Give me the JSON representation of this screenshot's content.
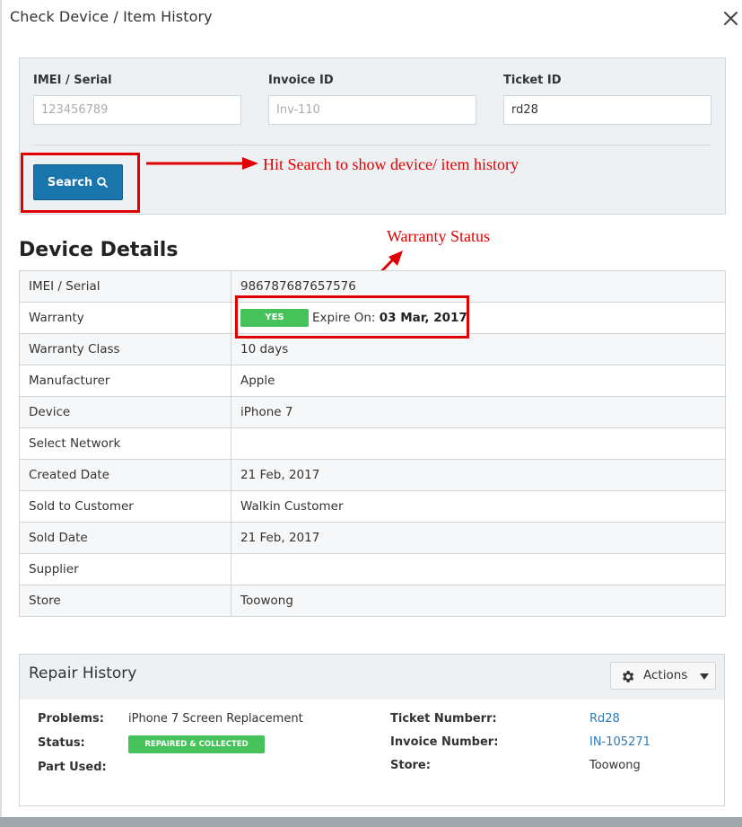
{
  "modal": {
    "title": "Check Device / Item History",
    "close_icon": "close-icon"
  },
  "search": {
    "imei_label": "IMEI / Serial",
    "imei_placeholder": "123456789",
    "imei_value": "",
    "invoice_label": "Invoice ID",
    "invoice_placeholder": "Inv-110",
    "invoice_value": "",
    "ticket_label": "Ticket ID",
    "ticket_placeholder": "",
    "ticket_value": "rd28",
    "button_label": "Search",
    "button_icon": "search-icon",
    "button_color": "#1b75ad"
  },
  "annotations": {
    "search_hint": "Hit Search to show device/ item history",
    "warranty_hint": "Warranty Status",
    "color": "#e00000"
  },
  "device_details": {
    "title": "Device Details",
    "rows": [
      {
        "key": "IMEI / Serial",
        "value": "986787687657576"
      },
      {
        "key": "Warranty",
        "value": ""
      },
      {
        "key": "Warranty Class",
        "value": "10 days"
      },
      {
        "key": "Manufacturer",
        "value": "Apple"
      },
      {
        "key": "Device",
        "value": "iPhone 7"
      },
      {
        "key": "Select Network",
        "value": ""
      },
      {
        "key": "Created Date",
        "value": "21 Feb, 2017"
      },
      {
        "key": "Sold to Customer",
        "value": "Walkin Customer"
      },
      {
        "key": "Sold Date",
        "value": "21 Feb, 2017"
      },
      {
        "key": "Supplier",
        "value": ""
      },
      {
        "key": "Store",
        "value": "Toowong"
      }
    ],
    "warranty": {
      "badge": "YES",
      "badge_color": "#45c25a",
      "expire_label": "Expire On:",
      "expire_date": "03 Mar, 2017"
    }
  },
  "repair_history": {
    "title": "Repair History",
    "actions_label": "Actions",
    "actions_icon": "gear-icon",
    "problems_label": "Problems:",
    "problems_value": "iPhone 7 Screen Replacement",
    "status_label": "Status:",
    "status_value": "REPAIRED & COLLECTED",
    "part_used_label": "Part Used:",
    "ticket_label": "Ticket Numberr:",
    "ticket_value": "Rd28",
    "invoice_label": "Invoice Number:",
    "invoice_value": "IN-105271",
    "store_label": "Store:",
    "store_value": "Toowong"
  }
}
